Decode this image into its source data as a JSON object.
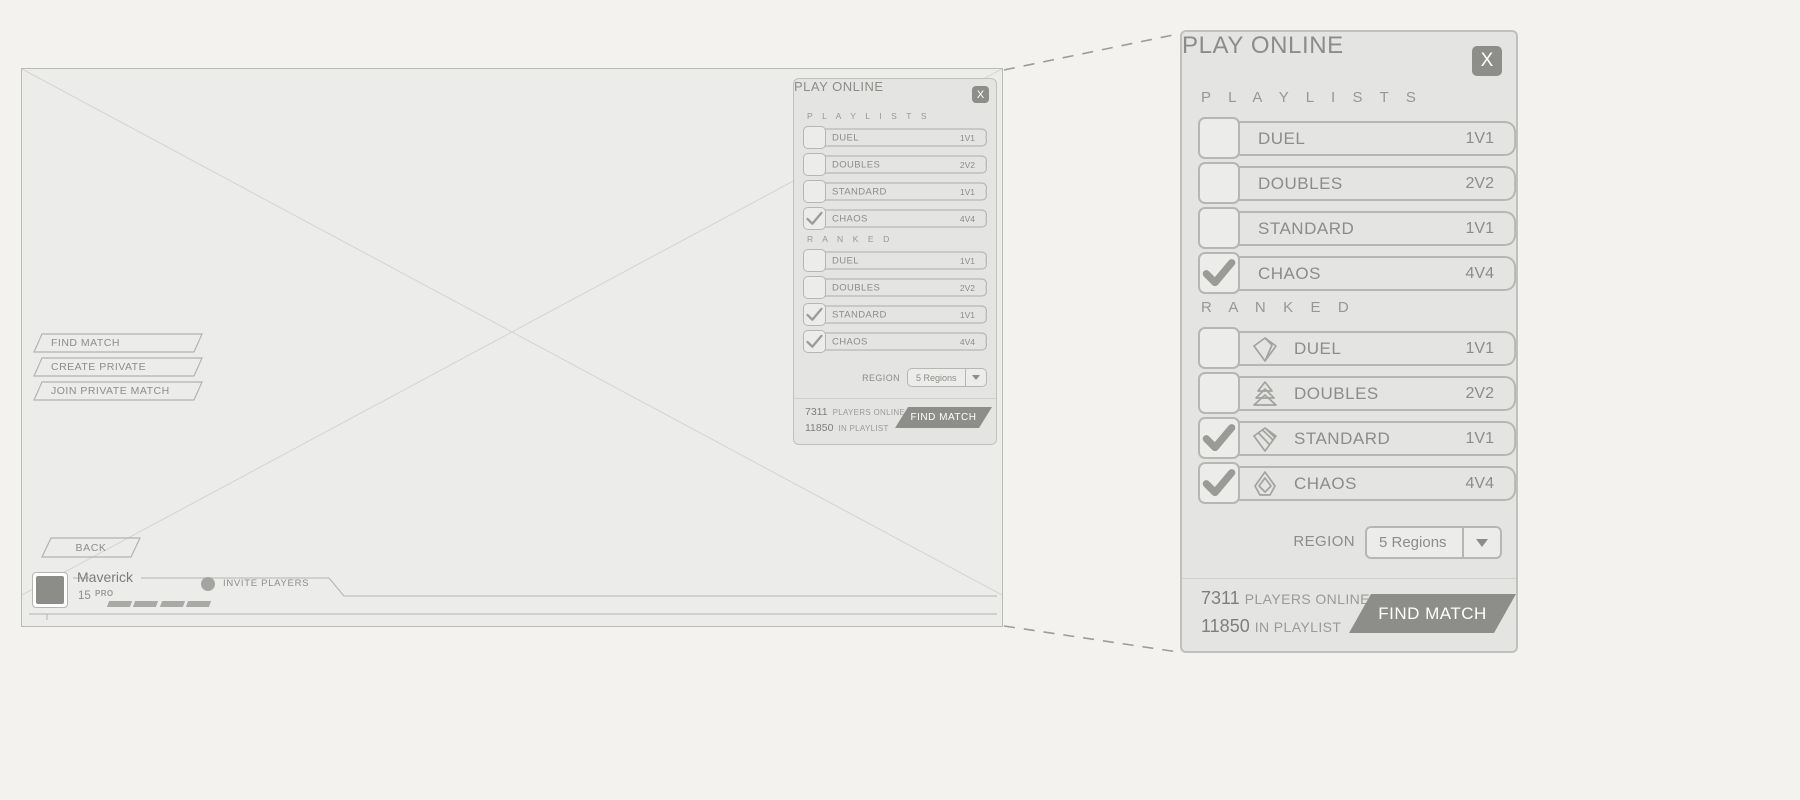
{
  "wireframe": {
    "nav_buttons": [
      {
        "label": "FIND MATCH"
      },
      {
        "label": "CREATE PRIVATE"
      },
      {
        "label": "JOIN PRIVATE MATCH"
      }
    ],
    "back_label": "BACK",
    "player": {
      "name": "Maverick",
      "level": "15",
      "rank_badge": "PRO",
      "invite_label": "INVITE PLAYERS"
    }
  },
  "panel": {
    "title": "PLAY ONLINE",
    "close_label": "X",
    "sections": [
      {
        "heading": "P L A Y L I S T S",
        "rows": [
          {
            "label": "DUEL",
            "count": "1V1",
            "checked": false,
            "rank_icon": ""
          },
          {
            "label": "DOUBLES",
            "count": "2V2",
            "checked": false,
            "rank_icon": ""
          },
          {
            "label": "STANDARD",
            "count": "1V1",
            "checked": false,
            "rank_icon": ""
          },
          {
            "label": "CHAOS",
            "count": "4V4",
            "checked": true,
            "rank_icon": ""
          }
        ]
      },
      {
        "heading": "R A N K E D",
        "rows": [
          {
            "label": "DUEL",
            "count": "1V1",
            "checked": false,
            "rank_icon": "gem-plain-icon"
          },
          {
            "label": "DOUBLES",
            "count": "2V2",
            "checked": false,
            "rank_icon": "gem-stacked-icon"
          },
          {
            "label": "STANDARD",
            "count": "1V1",
            "checked": true,
            "rank_icon": "gem-striped-icon"
          },
          {
            "label": "CHAOS",
            "count": "4V4",
            "checked": true,
            "rank_icon": "gem-diamond-icon"
          }
        ]
      }
    ],
    "region": {
      "label": "REGION",
      "value": "5 Regions",
      "caret_icon": "chevron-down-icon"
    },
    "footer": {
      "players_online_count": "7311",
      "players_online_label": "PLAYERS ONLINE",
      "in_playlist_count": "11850",
      "in_playlist_label": "IN PLAYLIST",
      "find_match_label": "FIND MATCH"
    }
  },
  "colors": {
    "page_bg": "#f3f2ee",
    "panel_bg": "#e4e4e2",
    "panel_border": "#c0c0bd",
    "text": "#8c8c89",
    "accent_button": "#8d8d8a",
    "wireframe_bg": "#ececeb"
  }
}
